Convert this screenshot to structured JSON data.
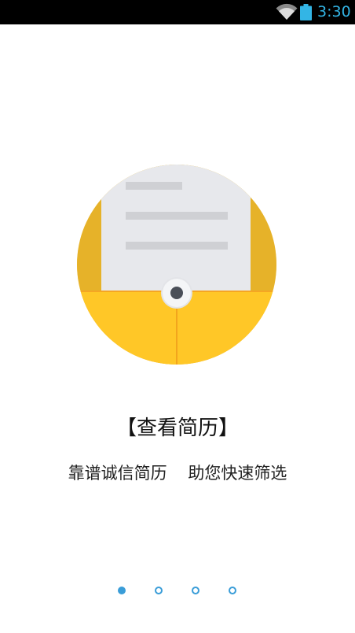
{
  "status_bar": {
    "time": "3:30",
    "wifi_icon": "wifi-icon",
    "battery_icon": "battery-icon"
  },
  "illustration": {
    "icon": "resume-envelope-illustration",
    "colors": {
      "circle_back": "#f6c437",
      "circle_front": "#ffc727",
      "paper": "#e7e8ec",
      "lines": "#cfd0d4",
      "button": "#4a4f58"
    }
  },
  "page": {
    "title": "【查看简历】",
    "subtitle": "靠谱诚信简历    助您快速筛选"
  },
  "pager": {
    "pages": 4,
    "active_index": 0,
    "color": "#3a9dd8"
  }
}
